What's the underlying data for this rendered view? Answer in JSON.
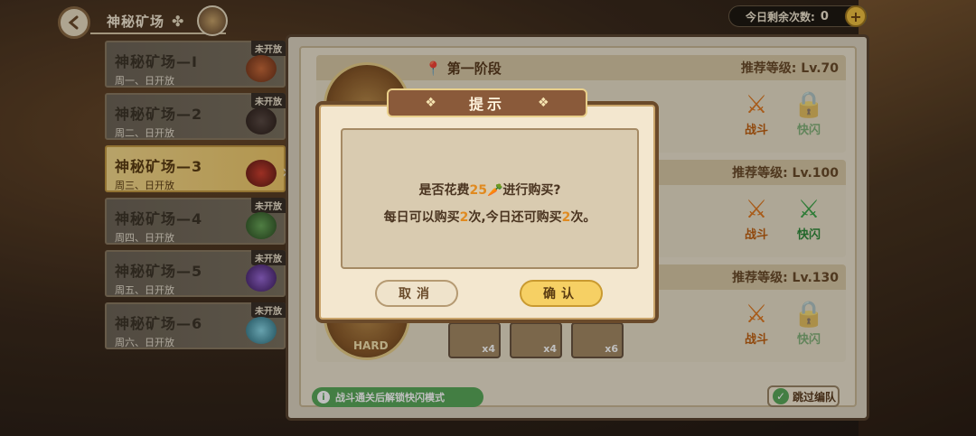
{
  "header": {
    "title": "神秘矿场",
    "counter_label": "今日剩余次数:",
    "counter_value": "0",
    "plus_label": "+"
  },
  "mines": [
    {
      "name": "神秘矿场—Ⅰ",
      "days": "周一、日开放",
      "status": "未开放"
    },
    {
      "name": "神秘矿场—2",
      "days": "周二、日开放",
      "status": "未开放"
    },
    {
      "name": "神秘矿场—3",
      "days": "周三、日开放",
      "status": "",
      "active": true
    },
    {
      "name": "神秘矿场—4",
      "days": "周四、日开放",
      "status": "未开放"
    },
    {
      "name": "神秘矿场—5",
      "days": "周五、日开放",
      "status": "未开放"
    },
    {
      "name": "神秘矿场—6",
      "days": "周六、日开放",
      "status": "未开放"
    }
  ],
  "stages": [
    {
      "title": "第一阶段",
      "rec": "推荐等级: Lv.70",
      "fight": "战斗",
      "flash": "快闪"
    },
    {
      "title": "",
      "rec": "推荐等级: Lv.100",
      "fight": "战斗",
      "flash": "快闪"
    },
    {
      "title": "",
      "rec": "推荐等级: Lv.130",
      "fight": "战斗",
      "flash": "快闪",
      "difficulty": "HARD"
    }
  ],
  "rewards": [
    "x4",
    "x4",
    "x6"
  ],
  "footer": {
    "unlock_hint": "战斗通关后解锁快闪模式",
    "info_label": "i",
    "skip_team": "跳过编队",
    "check_mark": "✓"
  },
  "dialog": {
    "title": "提示",
    "line1_prefix": "是否花费",
    "line1_amount": "25",
    "line1_suffix": "进行购买?",
    "line2_a": "每日可以购买",
    "line2_n1": "2",
    "line2_b": "次,今日还可购买",
    "line2_n2": "2",
    "line2_c": "次。",
    "cancel": "取消",
    "confirm": "确认"
  },
  "colors": {
    "accent": "#f6d064",
    "highlight_number": "#e08a20",
    "fight": "#e07a22",
    "flash": "#3ea64a"
  }
}
